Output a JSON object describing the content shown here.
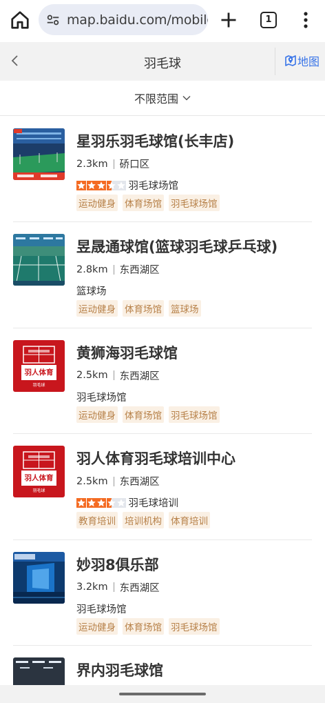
{
  "browser": {
    "url": "map.baidu.com/mobile/webapp",
    "tab_count": "1",
    "icons": [
      "home-icon",
      "site-settings-icon",
      "plus-icon",
      "tabs-icon",
      "more-vert-icon"
    ]
  },
  "header": {
    "title": "羽毛球",
    "map_label": "地图"
  },
  "filter": {
    "label": "不限范围"
  },
  "colors": {
    "accent": "#3874e8",
    "star": "#f46b22",
    "tag_text": "#b78149",
    "tag_bg": "#faf0e4"
  },
  "results": [
    {
      "name": "星羽乐羽毛球馆(长丰店)",
      "distance": "2.3km",
      "district": "硚口区",
      "rating": 3.5,
      "category": "羽毛球场馆",
      "tags": [
        "运动健身",
        "体育场馆",
        "羽毛球场馆"
      ]
    },
    {
      "name": "昱晟通球馆(篮球羽毛球乒乓球)",
      "distance": "2.8km",
      "district": "东西湖区",
      "category": "篮球场",
      "tags": [
        "运动健身",
        "体育场馆",
        "篮球场"
      ]
    },
    {
      "name": "黄狮海羽毛球馆",
      "distance": "2.5km",
      "district": "东西湖区",
      "category": "羽毛球场馆",
      "tags": [
        "运动健身",
        "体育场馆",
        "羽毛球场馆"
      ],
      "thumb_text": "羽人体育",
      "thumb_sub": "羽毛球"
    },
    {
      "name": "羽人体育羽毛球培训中心",
      "distance": "2.5km",
      "district": "东西湖区",
      "rating": 3.5,
      "category": "羽毛球培训",
      "tags": [
        "教育培训",
        "培训机构",
        "体育培训"
      ],
      "thumb_text": "羽人体育",
      "thumb_sub": "羽毛球"
    },
    {
      "name": "妙羽8俱乐部",
      "distance": "3.2km",
      "district": "东西湖区",
      "category": "羽毛球场馆",
      "tags": [
        "运动健身",
        "体育场馆",
        "羽毛球场馆"
      ]
    },
    {
      "name": "界内羽毛球馆"
    }
  ]
}
